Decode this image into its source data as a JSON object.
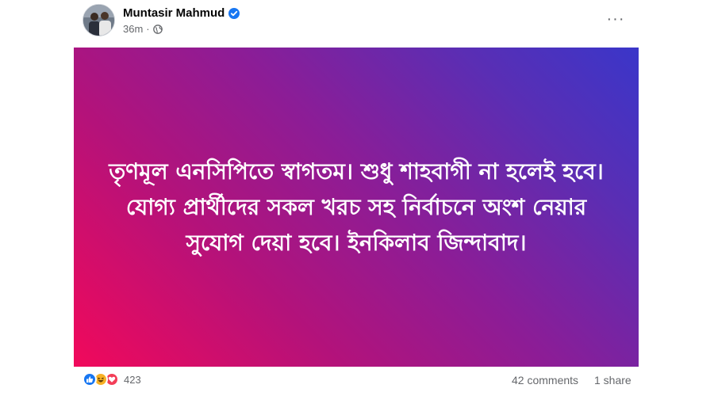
{
  "author": {
    "name": "Muntasir Mahmud",
    "verified": true,
    "time": "36m",
    "separator": "·",
    "audience_icon": "globe-icon"
  },
  "more_button": {
    "icon": "more-horizontal-icon",
    "label": "···"
  },
  "post": {
    "background_start": "#f1095b",
    "background_end": "#3a36c9",
    "text_color": "#ffffff",
    "text": "তৃণমূল এনসিপিতে স্বাগতম। শুধু শাহবাগী না হলেই হবে। যোগ্য প্রার্থীদের সকল খরচ সহ নির্বাচনে অংশ নেয়ার সুযোগ দেয়া হবে। ইনকিলাব জিন্দাবাদ।"
  },
  "engagement": {
    "reactions": [
      "like-icon",
      "haha-icon",
      "love-icon"
    ],
    "reaction_count": "423",
    "comments": "42 comments",
    "shares": "1 share"
  }
}
